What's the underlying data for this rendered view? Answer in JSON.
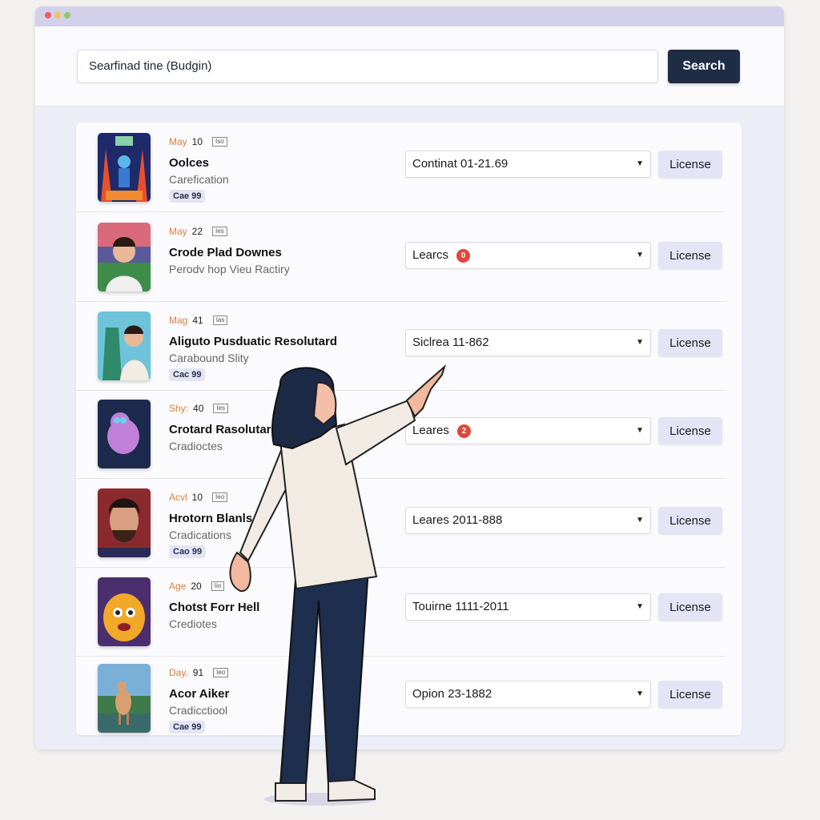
{
  "window": {
    "controls": [
      "close",
      "minimize",
      "maximize"
    ],
    "colors": {
      "titlebar": "#d3d0ea",
      "accent_button": "#1f2d44",
      "license_button": "#e3e5f6",
      "badge": "#e2463a",
      "month": "#e07f3a"
    }
  },
  "search": {
    "value": "Searfinad tine (Budgin)",
    "button_label": "Search"
  },
  "items": [
    {
      "month": "May",
      "day": "10",
      "tag": "Iso",
      "title": "Oolces",
      "subtitle": "Carefication",
      "chip": "Cae 99",
      "select_value": "Continat 01-21.69",
      "badge": "",
      "license_label": "License",
      "thumb": "robot-art"
    },
    {
      "month": "May",
      "day": "22",
      "tag": "Ies",
      "title": "Crode Plad Downes",
      "subtitle": "Perodv hop Vieu Ractiry",
      "chip": "",
      "select_value": "Learcs",
      "badge": "0",
      "license_label": "License",
      "thumb": "man-portrait"
    },
    {
      "month": "Mag",
      "day": "41",
      "tag": "Ias",
      "title": "Aliguto Pusduatic Resolutard",
      "subtitle": "Carabound Slity",
      "chip": "Cac 99",
      "select_value": "Siclrea  11-862",
      "badge": "",
      "license_label": "License",
      "thumb": "boy-plant"
    },
    {
      "month": "Shy:",
      "day": "40",
      "tag": "Ies",
      "title": "Crotard Rasolutard",
      "subtitle": "Cradioctes",
      "chip": "",
      "select_value": "Leares",
      "badge": "2",
      "license_label": "License",
      "thumb": "pink-creature"
    },
    {
      "month": "Acvl",
      "day": "10",
      "tag": "Ieo",
      "title": "Hrotorn Blanls",
      "subtitle": "Cradications",
      "chip": "Cao 99",
      "select_value": "Leares 2011-888",
      "badge": "",
      "license_label": "License",
      "thumb": "bearded-man"
    },
    {
      "month": "Age",
      "day": "20",
      "tag": "Iio",
      "title": "Chotst Forr Hell",
      "subtitle": "Crediotes",
      "chip": "",
      "select_value": "Touirne 1111-2011",
      "badge": "",
      "license_label": "License",
      "thumb": "yellow-monster"
    },
    {
      "month": "Day.",
      "day": "91",
      "tag": "Ieo",
      "title": "Acor Aiker",
      "subtitle": "Cradicctiool",
      "chip": "Cae 99",
      "select_value": "Opion 23-1882",
      "badge": "",
      "license_label": "License",
      "thumb": "camel-landscape"
    }
  ]
}
